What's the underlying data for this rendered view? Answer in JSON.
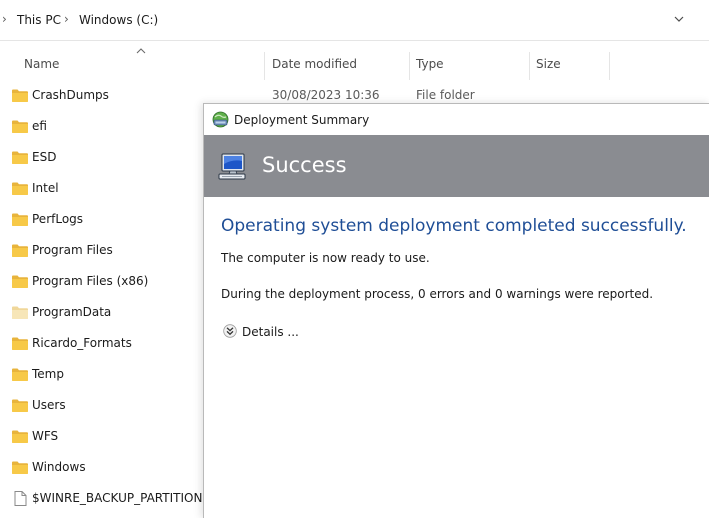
{
  "explorer": {
    "breadcrumb": [
      "This PC",
      "Windows (C:)"
    ],
    "columns": {
      "name": "Name",
      "date_modified": "Date modified",
      "type": "Type",
      "size": "Size"
    },
    "files": [
      {
        "name": "CrashDumps",
        "date": "30/08/2023 10:36",
        "type": "File folder",
        "kind": "folder"
      },
      {
        "name": "efi",
        "date": "",
        "type": "",
        "kind": "folder"
      },
      {
        "name": "ESD",
        "date": "",
        "type": "",
        "kind": "folder"
      },
      {
        "name": "Intel",
        "date": "",
        "type": "",
        "kind": "folder"
      },
      {
        "name": "PerfLogs",
        "date": "",
        "type": "",
        "kind": "folder"
      },
      {
        "name": "Program Files",
        "date": "",
        "type": "",
        "kind": "folder"
      },
      {
        "name": "Program Files (x86)",
        "date": "",
        "type": "",
        "kind": "folder"
      },
      {
        "name": "ProgramData",
        "date": "",
        "type": "",
        "kind": "folder-hidden"
      },
      {
        "name": "Ricardo_Formats",
        "date": "",
        "type": "",
        "kind": "folder"
      },
      {
        "name": "Temp",
        "date": "",
        "type": "",
        "kind": "folder"
      },
      {
        "name": "Users",
        "date": "",
        "type": "",
        "kind": "folder"
      },
      {
        "name": "WFS",
        "date": "",
        "type": "",
        "kind": "folder"
      },
      {
        "name": "Windows",
        "date": "",
        "type": "",
        "kind": "folder"
      },
      {
        "name": "$WINRE_BACKUP_PARTITION.MA",
        "date": "",
        "type": "",
        "kind": "file"
      }
    ]
  },
  "dialog": {
    "title": "Deployment Summary",
    "banner_title": "Success",
    "heading": "Operating system deployment completed successfully.",
    "line1": "The computer is now ready to use.",
    "line2": "During the deployment process, 0 errors and 0 warnings were reported.",
    "details_label": "Details ...",
    "colors": {
      "banner": "#8a8c91",
      "heading": "#1f4e96"
    }
  },
  "icons": {
    "breadcrumb_separator": "chevron-right-icon",
    "address_dropdown": "chevron-down-icon",
    "sort": "sort-ascending-icon",
    "folder": "folder-icon",
    "file": "file-icon",
    "dialog_title": "deployment-icon",
    "banner": "computer-icon",
    "details": "expand-chevron-icon"
  }
}
